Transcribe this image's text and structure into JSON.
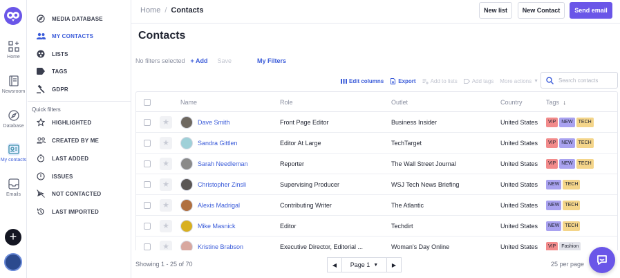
{
  "rail": {
    "items": [
      {
        "label": "Home",
        "icon": "apps-grid-icon"
      },
      {
        "label": "Newsroom",
        "icon": "notebook-icon"
      },
      {
        "label": "Database",
        "icon": "compass-icon"
      },
      {
        "label": "My contacts",
        "icon": "contact-card-icon",
        "active": true
      },
      {
        "label": "Emails",
        "icon": "inbox-icon"
      }
    ],
    "fab_label": "+"
  },
  "sidenav": {
    "items": [
      {
        "label": "MEDIA DATABASE",
        "icon": "compass-icon"
      },
      {
        "label": "MY CONTACTS",
        "icon": "people-icon",
        "active": true
      },
      {
        "label": "LISTS",
        "icon": "globe-icon"
      },
      {
        "label": "TAGS",
        "icon": "tag-icon"
      },
      {
        "label": "GDPR",
        "icon": "gavel-icon"
      }
    ],
    "quick_filters_title": "Quick filters",
    "quick_filters": [
      {
        "label": "HIGHLIGHTED",
        "icon": "star-icon"
      },
      {
        "label": "CREATED BY ME",
        "icon": "people-outline-icon"
      },
      {
        "label": "LAST ADDED",
        "icon": "timer-icon"
      },
      {
        "label": "ISSUES",
        "icon": "alert-circle-icon"
      },
      {
        "label": "NOT CONTACTED",
        "icon": "no-send-icon"
      },
      {
        "label": "LAST IMPORTED",
        "icon": "history-icon"
      }
    ]
  },
  "header": {
    "breadcrumb_home": "Home",
    "breadcrumb_sep": "/",
    "breadcrumb_current": "Contacts",
    "new_list": "New list",
    "new_contact": "New Contact",
    "send_email": "Send email"
  },
  "page_title": "Contacts",
  "filters": {
    "none": "No filters selected",
    "add": "+ Add",
    "save": "Save",
    "my_filters": "My Filters"
  },
  "toolbar": {
    "edit_columns": "Edit columns",
    "export": "Export",
    "add_to_lists": "Add to lists",
    "add_tags": "Add tags",
    "more_actions": "More actions",
    "search_placeholder": "Search contacts"
  },
  "table": {
    "columns": [
      "Name",
      "Role",
      "Outlet",
      "Country",
      "Tags"
    ],
    "rows": [
      {
        "name": "Dave Smith",
        "role": "Front Page Editor",
        "outlet": "Business Insider",
        "country": "United States",
        "tags": [
          "VIP",
          "NEW",
          "TECH"
        ]
      },
      {
        "name": "Sandra Gittlen",
        "role": "Editor At Large",
        "outlet": "TechTarget",
        "country": "United States",
        "tags": [
          "VIP",
          "NEW",
          "TECH"
        ]
      },
      {
        "name": "Sarah Needleman",
        "role": "Reporter",
        "outlet": "The Wall Street Journal",
        "country": "United States",
        "tags": [
          "VIP",
          "NEW",
          "TECH"
        ]
      },
      {
        "name": "Christopher Zinsli",
        "role": "Supervising Producer",
        "outlet": "WSJ Tech News Briefing",
        "country": "United States",
        "tags": [
          "NEW",
          "TECH"
        ]
      },
      {
        "name": "Alexis Madrigal",
        "role": "Contributing Writer",
        "outlet": "The Atlantic",
        "country": "United States",
        "tags": [
          "NEW",
          "TECH"
        ]
      },
      {
        "name": "Mike Masnick",
        "role": "Editor",
        "outlet": "Techdirt",
        "country": "United States",
        "tags": [
          "NEW",
          "TECH"
        ]
      },
      {
        "name": "Kristine Brabson",
        "role": "Executive Director, Editorial ...",
        "outlet": "Woman's Day Online",
        "country": "United States",
        "tags": [
          "VIP",
          "Fashion"
        ]
      }
    ]
  },
  "tag_colors": {
    "VIP": "#f28b8b",
    "NEW": "#a9a2f0",
    "TECH": "#f4d58a",
    "Fashion": "#e2e3ea"
  },
  "footer": {
    "showing": "Showing 1 - 25 of 70",
    "page": "Page 1",
    "per_page": "25 per page"
  },
  "colors": {
    "accent": "#6a56e8",
    "link": "#3a5bd9"
  }
}
